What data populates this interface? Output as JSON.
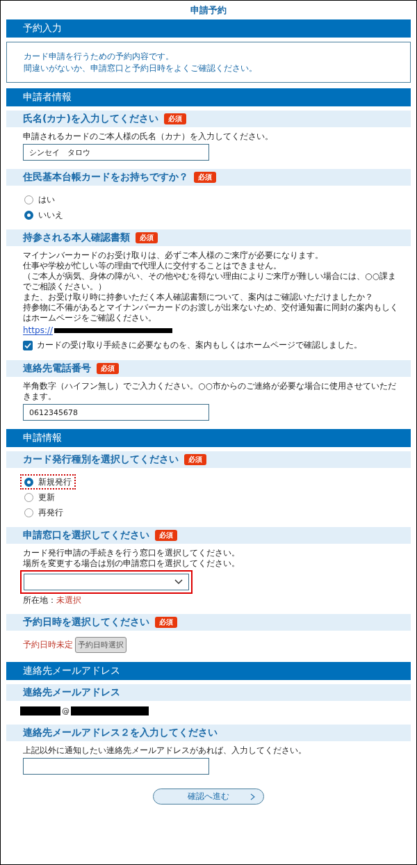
{
  "title": "申請予約",
  "sections": [
    {
      "heading": "予約入力",
      "items": [
        {
          "kind": "notice",
          "lines": [
            "カード申請を行うための予約内容です。",
            "間違いがないか、申請窓口と予約日時をよくご確認ください。"
          ]
        }
      ]
    },
    {
      "heading": "申請者情報",
      "items": [
        {
          "kind": "question",
          "label": "氏名(カナ)を入力してください",
          "badge": "必須",
          "notes": [
            "申請されるカードのご本人様の氏名（カナ）を入力してください。"
          ],
          "input": {
            "kind": "text",
            "value": "シンセイ　タロウ"
          }
        },
        {
          "kind": "question",
          "label": "住民基本台帳カードをお持ちですか？",
          "badge": "必須",
          "radios": [
            {
              "label": "はい",
              "selected": false,
              "annotated": false
            },
            {
              "label": "いいえ",
              "selected": true,
              "annotated": false
            }
          ]
        },
        {
          "kind": "question",
          "label": "持参される本人確認書類",
          "badge": "必須",
          "notes": [
            "マイナンバーカードのお受け取りは、必ずご本人様のご来庁が必要になります。",
            "仕事や学校が忙しい等の理由で代理人に交付することはできません。",
            "（ご本人が病気、身体の障がい、その他やむを得ない理由によりご来庁が難しい場合には、○○課までご相談ください。）",
            "また、お受け取り時に持参いただく本人確認書類について、案内はご確認いただけましたか？",
            "持参物に不備があるとマイナンバーカードのお渡しが出来ないため、交付通知書に同封の案内もしくはホームページをご確認ください。"
          ],
          "link": "https://",
          "checkbox": {
            "label": "カードの受け取り手続きに必要なものを、案内もしくはホームページで確認しました。",
            "checked": true
          }
        },
        {
          "kind": "question",
          "label": "連絡先電話番号",
          "badge": "必須",
          "notes": [
            "半角数字（ハイフン無し）でご入力ください。○○市からのご連絡が必要な場合に使用させていただきます。"
          ],
          "input": {
            "kind": "text",
            "value": "0612345678"
          }
        }
      ]
    },
    {
      "heading": "申請情報",
      "items": [
        {
          "kind": "question",
          "label": "カード発行種別を選択してください",
          "badge": "必須",
          "radios": [
            {
              "label": "新規発行",
              "selected": true,
              "annotated": true
            },
            {
              "label": "更新",
              "selected": false,
              "annotated": false
            },
            {
              "label": "再発行",
              "selected": false,
              "annotated": false
            }
          ]
        },
        {
          "kind": "question",
          "label": "申請窓口を選択してください",
          "badge": "必須",
          "notes": [
            "カード発行申請の手続きを行う窓口を選択してください。",
            "場所を変更する場合は別の申請窓口を選択してください。"
          ],
          "select": {
            "annotated": true
          },
          "location": {
            "label": "所在地：",
            "value": "未選択"
          }
        },
        {
          "kind": "question",
          "label": "予約日時を選択してください",
          "badge": "必須",
          "date": {
            "status": "予約日時未定",
            "button": "予約日時選択"
          }
        }
      ]
    },
    {
      "heading": "連絡先メールアドレス",
      "items": [
        {
          "kind": "question",
          "label": "連絡先メールアドレス",
          "email": {
            "at": "@"
          }
        },
        {
          "kind": "question",
          "label": "連絡先メールアドレス２を入力してください",
          "notes": [
            "上記以外に通知したい連絡先メールアドレスがあれば、入力してください。"
          ],
          "input": {
            "kind": "text"
          }
        }
      ]
    }
  ],
  "next_button": "確認へ進む"
}
